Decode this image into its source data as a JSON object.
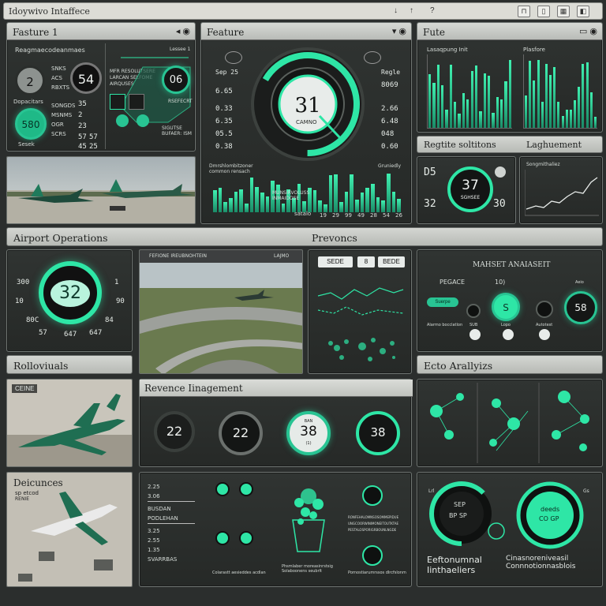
{
  "window": {
    "title": "Idoywivo Intaffece",
    "controls": [
      "↓",
      "↑",
      "?"
    ]
  },
  "colors": {
    "accent": "#2ee6a6",
    "panel": "#2b2e2d",
    "header": "#c8cbc6"
  },
  "feature1": {
    "title": "Fasture 1",
    "subtitle": "Reagmaecodeanmaes",
    "gauge_left": "2",
    "gauge_mid": "54",
    "gauge_accent": "580",
    "gauge_right": "06",
    "side_label": "Dopacitars",
    "bottom_label": "Sesek",
    "mid_texts": [
      "SNKS",
      "ACS",
      "RBXTS",
      "SONGDS",
      "MSNMS",
      "OGR",
      "SCRS"
    ],
    "nums_right": [
      "35",
      "2",
      "23",
      "57",
      "45",
      "57",
      "25"
    ],
    "col_texts": [
      "MFR RESOLUTSERE",
      "LARCAN SELFOME",
      "AIRQUSES"
    ],
    "right_label": "RSEFECRT",
    "bottom_right": "SIGUTSE\nBUFAER: ISM",
    "small_right": "Lessee 1"
  },
  "feature": {
    "title": "Feature",
    "center_value": "31",
    "center_label": "CAMNO",
    "left_vals": [
      "Sep 25",
      "6.65",
      "0.33",
      "6.35",
      "05.5",
      "0.38"
    ],
    "right_vals": [
      "Regle",
      "8069",
      "2.66",
      "6.48",
      "048",
      "0.60"
    ],
    "chart_label_left": "Dmrshlombitzoner\ncommon rensach",
    "chart_label_right": "Gruniedly",
    "bottom_text": "MUNSIRVOLUSS\nINMAIDOSE",
    "axis_label": "satalo",
    "axis_ticks": [
      "19",
      "29",
      "99",
      "49",
      "28",
      "54",
      "26"
    ]
  },
  "fute": {
    "title": "Fute",
    "left_label": "Lasaqpung Init",
    "right_label": "Plasfore"
  },
  "regite": {
    "title": "Regtite soltitons",
    "right_title": "Laghuement",
    "gauge_value": "37",
    "gauge_sub": "SGHSEE",
    "left_num_top": "D5",
    "left_num_bottom": "32",
    "right_num": "30",
    "right_chart_label": "Songmithaliez"
  },
  "airport": {
    "title": "Airport Operations",
    "center_title": "Prevoncs"
  },
  "ops_gauge": {
    "value": "32",
    "nums_left": [
      "300",
      "10",
      "80C",
      "57"
    ],
    "nums_right": [
      "1",
      "90",
      "84",
      "647"
    ],
    "bottom_mid": "647"
  },
  "runway_photo": {
    "title_left": "FEFIONE IREUBNOHTEIN",
    "title_right": "LAJMO"
  },
  "route_panel": {
    "tag1": "SEDE",
    "tag2": "8",
    "tag3": "BEDE"
  },
  "market": {
    "title": "MAHSET ANAIASEIT",
    "sub": "PEGACE",
    "sub2": "10)",
    "pill": "Suerpe",
    "small_labels": [
      "Alarmo bocclatlon",
      "SUB",
      "Lopo",
      "Autotest",
      "Aeio"
    ],
    "gauge_a": "S",
    "gauge_b": "58"
  },
  "rollovers": {
    "title": "Rolloviuals"
  },
  "ecto": {
    "title": "Ecto Arallyizs"
  },
  "plane_panel": {
    "label": "CEINE"
  },
  "revenue": {
    "title": "Revence Iinagement",
    "gauges": [
      "22",
      "22",
      "38",
      "38"
    ],
    "gauge3_sub_top": "BAN",
    "gauge3_sub_bottom": "(1)"
  },
  "deductions": {
    "title": "Deicunces",
    "sub": "sp etcod",
    "sub2": "RENIE"
  },
  "list_panel": {
    "rows": [
      "2.25",
      "3.06",
      "BUSDAN",
      "PODLEHAN",
      "3.25",
      "2.55",
      "1.35",
      "SVARRBAS"
    ],
    "footer": "Colarastt aesieddes acdlan",
    "center_caption": "Phsmlaber moreasinrstsig\nSolaboonens seubrlt",
    "right_lines": [
      "RONFEHALOMNSOSOMMEPIDUE",
      "UNGCOORWINIMONEITOUTKTAE",
      "PESTALOSPORIGRBOUNLNGDE"
    ],
    "right_caption": "Pornostiarumrssos dlrcfslonm"
  },
  "eftonal": {
    "title_a": "Eeftonumnal\nIinthaeliers",
    "title_b": "Cinasnoreniveasil\nConnnotionnasblois",
    "ring_a_top": "SEP",
    "ring_a_bottom": "BP SP",
    "ring_b_top": "deeds",
    "ring_b_bottom": "CO GP",
    "left_tag": "Lrl",
    "right_tag": "Gs"
  }
}
